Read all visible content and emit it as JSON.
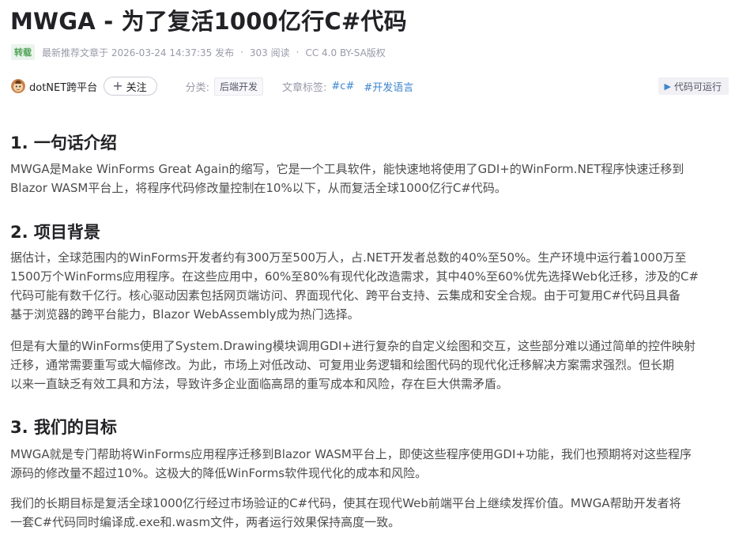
{
  "article": {
    "title": "MWGA - 为了复活1000亿行C#代码",
    "meta": {
      "badge": "转载",
      "published": "最新推荐文章于 2026-03-24 14:37:35 发布",
      "reads": "303 阅读",
      "license": "CC 4.0 BY-SA版权"
    },
    "author": {
      "name": "dotNET跨平台",
      "follow_label": "关注",
      "category_label": "分类:",
      "category": "后端开发",
      "tags_label": "文章标签:",
      "tags": [
        "#c#",
        "#开发语言"
      ],
      "run_label": "代码可运行"
    },
    "sections": [
      {
        "heading": "1. 一句话介绍",
        "paragraphs": [
          [
            "MWGA是Make WinForms Great Again的缩写，它是一个工具软件，能快速地将使用了GDI+的WinForm.NET程序快速迁移到",
            "Blazor WASM平台上，将程序代码修改量控制在10%以下，从而复活全球1000亿行C#代码。"
          ]
        ]
      },
      {
        "heading": "2. 项目背景",
        "paragraphs": [
          [
            "据估计，全球范围内的WinForms开发者约有300万至500万人，占.NET开发者总数的40%至50%。生产环境中运行着1000万至",
            "1500万个WinForms应用程序。在这些应用中，60%至80%有现代化改造需求，其中40%至60%优先选择Web化迁移，涉及的C#",
            "代码可能有数千亿行。核心驱动因素包括网页端访问、界面现代化、跨平台支持、云集成和安全合规。由于可复用C#代码且具备",
            "基于浏览器的跨平台能力，Blazor WebAssembly成为热门选择。"
          ],
          [
            "但是有大量的WinForms使用了System.Drawing模块调用GDI+进行复杂的自定义绘图和交互，这些部分难以通过简单的控件映射",
            "迁移，通常需要重写或大幅修改。为此，市场上对低改动、可复用业务逻辑和绘图代码的现代化迁移解决方案需求强烈。但长期",
            "以来一直缺乏有效工具和方法，导致许多企业面临高昂的重写成本和风险，存在巨大供需矛盾。"
          ]
        ]
      },
      {
        "heading": "3. 我们的目标",
        "paragraphs": [
          [
            "MWGA就是专门帮助将WinForms应用程序迁移到Blazor WASM平台上，即使这些程序使用GDI+功能，我们也预期将对这些程序",
            "源码的修改量不超过10%。这极大的降低WinForms软件现代化的成本和风险。"
          ],
          [
            "我们的长期目标是复活全球1000亿行经过市场验证的C#代码，使其在现代Web前端平台上继续发挥价值。MWGA帮助开发者将",
            "一套C#代码同时编译成.exe和.wasm文件，两者运行效果保持高度一致。"
          ]
        ]
      }
    ]
  }
}
